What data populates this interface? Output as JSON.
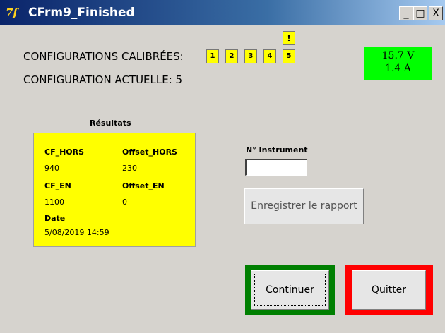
{
  "window": {
    "title": "CFrm9_Finished",
    "icon": "7f",
    "controls": {
      "minimize": "_",
      "maximize": "□",
      "close": "X"
    }
  },
  "status": {
    "configurations_label": "CONFIGURATIONS CALIBRÉES:",
    "configuration_buttons": [
      "1",
      "2",
      "3",
      "4",
      "5"
    ],
    "warning_badge": "!",
    "current_configuration_label": "CONFIGURATION ACTUELLE: 5"
  },
  "power": {
    "voltage": "15.7 V",
    "current": "1.4 A",
    "color": "#00ff00"
  },
  "results": {
    "title": "Résultats",
    "cf_hors_label": "CF_HORS",
    "cf_hors_value": "940",
    "offset_hors_label": "Offset_HORS",
    "offset_hors_value": "230",
    "cf_en_label": "CF_EN",
    "cf_en_value": "1100",
    "offset_en_label": "Offset_EN",
    "offset_en_value": "0",
    "date_label": "Date",
    "date_value": "5/08/2019 14:59",
    "color": "#ffff00"
  },
  "instrument": {
    "label": "N° Instrument",
    "value": ""
  },
  "actions": {
    "save_label": "Enregistrer le rapport",
    "continue_label": "Continuer",
    "continue_frame_color": "#007f00",
    "quit_label": "Quitter",
    "quit_frame_color": "#ff0000"
  }
}
